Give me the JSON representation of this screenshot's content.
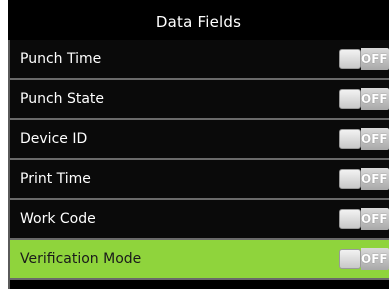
{
  "header": {
    "title": "Data Fields"
  },
  "fields": [
    {
      "label": "Punch Time",
      "state": "OFF",
      "selected": false
    },
    {
      "label": "Punch State",
      "state": "OFF",
      "selected": false
    },
    {
      "label": "Device ID",
      "state": "OFF",
      "selected": false
    },
    {
      "label": "Print Time",
      "state": "OFF",
      "selected": false
    },
    {
      "label": "Work Code",
      "state": "OFF",
      "selected": false
    },
    {
      "label": "Verification Mode",
      "state": "OFF",
      "selected": true
    }
  ],
  "colors": {
    "background": "#000000",
    "selected_row": "#8fd43c",
    "divider": "#6a6a6a"
  }
}
